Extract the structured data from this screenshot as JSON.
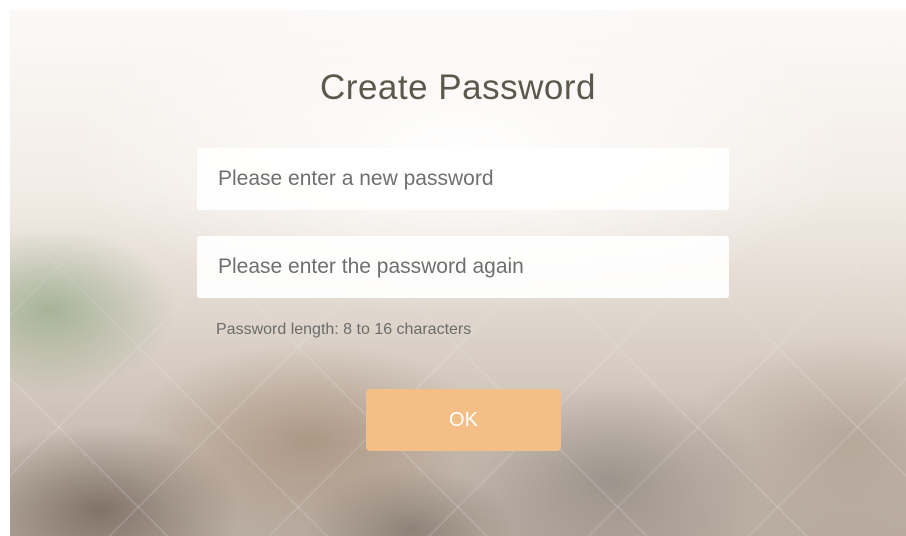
{
  "page": {
    "title": "Create Password"
  },
  "form": {
    "new_password": {
      "value": "",
      "placeholder": "Please enter a new password"
    },
    "confirm_password": {
      "value": "",
      "placeholder": "Please enter the password again"
    },
    "hint": "Password length: 8 to 16 characters",
    "ok_label": "OK"
  },
  "colors": {
    "accent": "#f3bf86",
    "title": "#5a5a4c"
  }
}
